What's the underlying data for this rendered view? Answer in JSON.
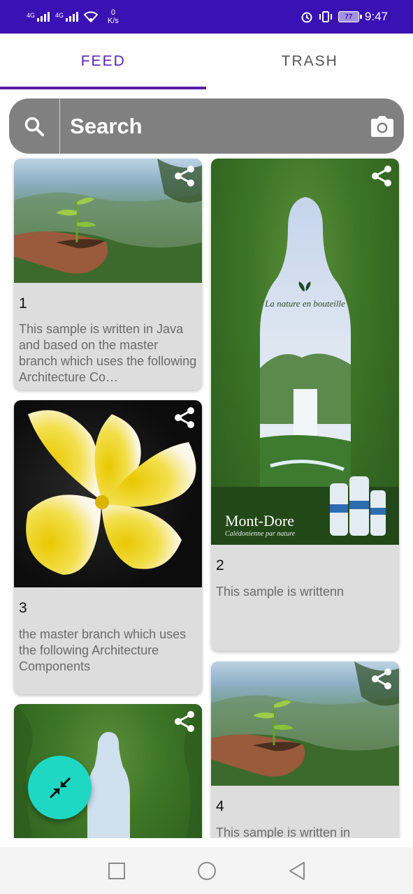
{
  "status_bar": {
    "sim1_label": "4G",
    "sim2_label": "4G",
    "speed_value": "0",
    "speed_unit": "K/s",
    "battery": "77",
    "time": "9:47",
    "icons": [
      "signal-icon",
      "wifi-icon",
      "alarm-icon",
      "vibrate-icon",
      "battery-icon"
    ]
  },
  "tabs": [
    {
      "label": "FEED",
      "active": true
    },
    {
      "label": "TRASH",
      "active": false
    }
  ],
  "search": {
    "placeholder": "Search",
    "icons": [
      "search-icon",
      "camera-icon"
    ]
  },
  "colors": {
    "status_bar": "#3a11b4",
    "tab_active": "#5a22b8",
    "search_bg": "#808080",
    "card_bg": "#dddddd",
    "fab": "#1fd8c4"
  },
  "cards": [
    {
      "number": "1",
      "description": "This sample is written in Java and based on the master branch which uses the following Architecture Co…",
      "image": "seedling-in-hands"
    },
    {
      "number": "2",
      "description": "This sample is writtenn",
      "image": "mont-dore-bottle-advert",
      "ad_tagline": "La nature en bouteille",
      "ad_brand": "Mont-Dore",
      "ad_subtitle": "Calédonienne par nature"
    },
    {
      "number": "3",
      "description": "the master branch which uses the following Architecture Components",
      "image": "frangipani-flower"
    },
    {
      "number": "4",
      "description": "This sample is written in",
      "image": "seedling-in-hands"
    },
    {
      "number": "",
      "description": "",
      "image": "mont-dore-bottle-advert"
    }
  ],
  "fab": {
    "icon": "collapse-arrows-icon"
  },
  "nav_bar": {
    "icons": [
      "recents-square-icon",
      "home-circle-icon",
      "back-triangle-icon"
    ]
  }
}
